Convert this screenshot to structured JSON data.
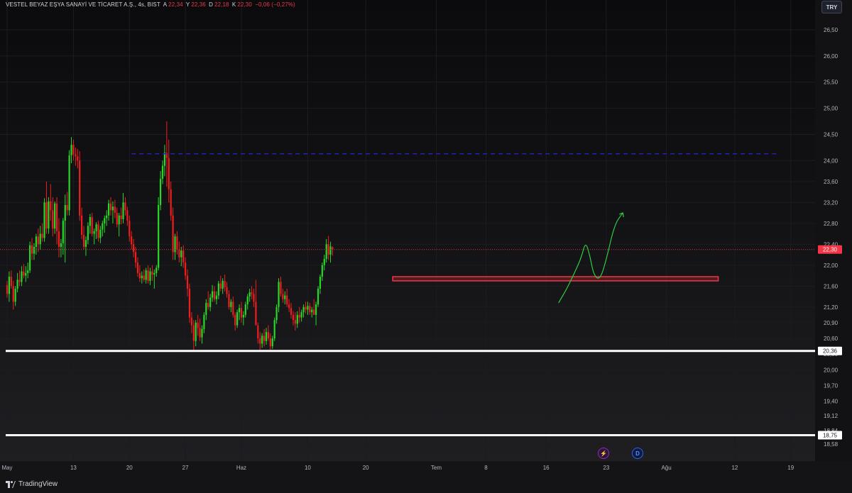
{
  "header": {
    "symbol": "VESTEL BEYAZ EŞYA SANAYİ VE TİCARET A.Ş., 4s, BIST",
    "open_label": "A",
    "open": "22,34",
    "high_label": "Y",
    "high": "22,36",
    "low_label": "D",
    "low": "22,18",
    "close_label": "K",
    "close": "22,30",
    "change": "−0,06 (−0,27%)"
  },
  "currency": "TRY",
  "footer": {
    "brand": "TradingView"
  },
  "event_icons": [
    {
      "icon": "lightning-icon",
      "glyph": "⚡",
      "color": "#9c27b0"
    },
    {
      "icon": "dividend-icon",
      "glyph": "D",
      "color": "#2962ff"
    }
  ],
  "chart_data": {
    "type": "candlestick",
    "ylim": [
      18.5,
      26.75
    ],
    "price_ticks": [
      "26,50",
      "26,00",
      "25,50",
      "25,00",
      "24,50",
      "24,00",
      "23,60",
      "23,20",
      "22,80",
      "22,40",
      "22,00",
      "21,60",
      "21,20",
      "20,90",
      "20,60",
      "20,30",
      "20,00",
      "19,70",
      "19,40",
      "19,12",
      "18,84",
      "18,58"
    ],
    "price_tick_values": [
      26.5,
      26.0,
      25.5,
      25.0,
      24.5,
      24.0,
      23.6,
      23.2,
      22.8,
      22.4,
      22.0,
      21.6,
      21.2,
      20.9,
      20.6,
      20.3,
      20.0,
      19.7,
      19.4,
      19.12,
      18.84,
      18.58
    ],
    "x_labels": [
      "May",
      "13",
      "20",
      "27",
      "Haz",
      "10",
      "20",
      "Tem",
      "8",
      "16",
      "23",
      "Ağu",
      "12",
      "19"
    ],
    "x_label_bars": [
      0,
      32,
      59,
      86,
      113,
      145,
      173,
      207,
      231,
      260,
      289,
      318,
      351,
      378
    ],
    "last_price": {
      "value": 22.3,
      "label": "22,30",
      "color": "#f23645"
    },
    "support_lines": [
      {
        "value": 20.36,
        "label": "20,36",
        "color": "#ffffff"
      },
      {
        "value": 18.75,
        "label": "18,75",
        "color": "#ffffff"
      }
    ],
    "resistance_dashed": {
      "value": 24.13,
      "start_bar": 60,
      "end_bar": 372,
      "color": "#2121b8"
    },
    "resistance_zone": {
      "top": 21.78,
      "bottom": 21.7,
      "start_bar": 186,
      "end_bar": 343,
      "color": "#f23645"
    },
    "projection_arrow": {
      "color": "#2ecc40",
      "points": [
        [
          266,
          21.28
        ],
        [
          270,
          21.55
        ],
        [
          274,
          21.88
        ],
        [
          277,
          22.15
        ],
        [
          279,
          22.45
        ],
        [
          281,
          22.2
        ],
        [
          283,
          21.8
        ],
        [
          286,
          21.72
        ],
        [
          289,
          22.1
        ],
        [
          293,
          22.78
        ],
        [
          297,
          23.0
        ]
      ]
    },
    "up_color": "#26d926",
    "down_color": "#f01d1d",
    "candles": [
      [
        21.62,
        21.7,
        21.38,
        21.45
      ],
      [
        21.45,
        21.88,
        21.3,
        21.78
      ],
      [
        21.78,
        21.9,
        21.55,
        21.6
      ],
      [
        21.6,
        21.7,
        21.15,
        21.3
      ],
      [
        21.3,
        21.6,
        21.22,
        21.55
      ],
      [
        21.55,
        21.85,
        21.48,
        21.72
      ],
      [
        21.72,
        21.9,
        21.6,
        21.68
      ],
      [
        21.68,
        21.98,
        21.6,
        21.88
      ],
      [
        21.88,
        22.02,
        21.75,
        21.8
      ],
      [
        21.8,
        21.98,
        21.68,
        21.85
      ],
      [
        21.85,
        22.05,
        21.75,
        21.9
      ],
      [
        21.9,
        22.45,
        21.85,
        22.38
      ],
      [
        22.38,
        22.52,
        22.1,
        22.22
      ],
      [
        22.22,
        22.42,
        22.1,
        22.35
      ],
      [
        22.35,
        22.6,
        22.2,
        22.55
      ],
      [
        22.55,
        22.7,
        22.25,
        22.4
      ],
      [
        22.4,
        22.75,
        22.3,
        22.6
      ],
      [
        22.6,
        22.8,
        22.45,
        22.52
      ],
      [
        22.52,
        23.28,
        22.45,
        23.2
      ],
      [
        23.2,
        23.6,
        22.6,
        22.7
      ],
      [
        22.7,
        23.3,
        22.6,
        23.22
      ],
      [
        23.22,
        23.55,
        22.85,
        23.05
      ],
      [
        23.05,
        23.3,
        22.55,
        22.7
      ],
      [
        22.7,
        23.22,
        22.6,
        23.18
      ],
      [
        23.18,
        23.3,
        22.4,
        22.65
      ],
      [
        22.65,
        22.9,
        22.15,
        22.35
      ],
      [
        22.35,
        22.5,
        22.15,
        22.42
      ],
      [
        22.42,
        22.9,
        22.2,
        22.85
      ],
      [
        22.85,
        23.35,
        22.05,
        23.15
      ],
      [
        23.15,
        23.4,
        22.95,
        23.05
      ],
      [
        23.05,
        24.2,
        22.95,
        24.1
      ],
      [
        24.1,
        24.45,
        23.95,
        24.3
      ],
      [
        24.3,
        24.4,
        24.0,
        24.12
      ],
      [
        24.12,
        24.25,
        23.9,
        24.08
      ],
      [
        24.08,
        24.22,
        23.85,
        24.0
      ],
      [
        24.0,
        24.18,
        22.85,
        22.95
      ],
      [
        22.95,
        23.1,
        22.5,
        22.58
      ],
      [
        22.58,
        22.75,
        22.3,
        22.35
      ],
      [
        22.35,
        22.55,
        22.18,
        22.48
      ],
      [
        22.48,
        22.82,
        22.4,
        22.75
      ],
      [
        22.75,
        22.98,
        22.6,
        22.92
      ],
      [
        22.92,
        23.0,
        22.55,
        22.6
      ],
      [
        22.6,
        22.7,
        22.4,
        22.65
      ],
      [
        22.65,
        22.82,
        22.5,
        22.78
      ],
      [
        22.78,
        22.85,
        22.45,
        22.52
      ],
      [
        22.52,
        22.75,
        22.42,
        22.68
      ],
      [
        22.68,
        22.85,
        22.55,
        22.8
      ],
      [
        22.8,
        22.95,
        22.62,
        22.9
      ],
      [
        22.9,
        23.05,
        22.75,
        22.95
      ],
      [
        22.95,
        23.25,
        22.85,
        23.18
      ],
      [
        23.18,
        23.3,
        22.95,
        23.05
      ],
      [
        23.05,
        23.22,
        22.8,
        23.12
      ],
      [
        23.12,
        23.25,
        22.9,
        23.0
      ],
      [
        23.0,
        23.1,
        22.72,
        22.78
      ],
      [
        22.78,
        23.0,
        22.55,
        22.95
      ],
      [
        22.95,
        23.1,
        22.78,
        22.88
      ],
      [
        22.88,
        23.38,
        22.8,
        23.2
      ],
      [
        23.2,
        23.3,
        22.95,
        23.05
      ],
      [
        23.05,
        23.12,
        22.75,
        22.85
      ],
      [
        22.85,
        22.95,
        22.45,
        22.55
      ],
      [
        22.55,
        22.65,
        22.3,
        22.4
      ],
      [
        22.4,
        22.5,
        22.15,
        22.25
      ],
      [
        22.25,
        22.35,
        21.95,
        22.05
      ],
      [
        22.05,
        22.15,
        21.78,
        21.85
      ],
      [
        21.85,
        22.0,
        21.68,
        21.75
      ],
      [
        21.75,
        21.88,
        21.65,
        21.8
      ],
      [
        21.8,
        21.92,
        21.68,
        21.72
      ],
      [
        21.72,
        21.95,
        21.65,
        21.9
      ],
      [
        21.9,
        22.0,
        21.65,
        21.7
      ],
      [
        21.7,
        21.95,
        21.62,
        21.88
      ],
      [
        21.88,
        22.0,
        21.7,
        21.82
      ],
      [
        21.82,
        21.92,
        21.55,
        21.85
      ],
      [
        21.85,
        22.0,
        21.78,
        21.95
      ],
      [
        21.95,
        23.3,
        21.9,
        23.15
      ],
      [
        23.15,
        23.8,
        23.05,
        23.65
      ],
      [
        23.65,
        24.0,
        23.55,
        23.9
      ],
      [
        23.9,
        24.3,
        23.7,
        24.15
      ],
      [
        24.15,
        24.75,
        23.5,
        24.05
      ],
      [
        24.05,
        24.4,
        23.2,
        23.45
      ],
      [
        23.45,
        23.6,
        22.85,
        22.95
      ],
      [
        22.95,
        23.1,
        22.1,
        22.25
      ],
      [
        22.25,
        22.6,
        22.1,
        22.55
      ],
      [
        22.55,
        22.65,
        22.2,
        22.3
      ],
      [
        22.3,
        22.45,
        22.05,
        22.15
      ],
      [
        22.15,
        22.35,
        21.98,
        22.28
      ],
      [
        22.28,
        22.38,
        21.95,
        22.05
      ],
      [
        22.05,
        22.15,
        21.72,
        21.8
      ],
      [
        21.8,
        21.92,
        21.4,
        21.55
      ],
      [
        21.55,
        21.65,
        20.9,
        21.0
      ],
      [
        21.0,
        21.1,
        20.7,
        20.85
      ],
      [
        20.85,
        20.95,
        20.35,
        20.55
      ],
      [
        20.55,
        20.95,
        20.45,
        20.9
      ],
      [
        20.9,
        21.05,
        20.65,
        20.8
      ],
      [
        20.8,
        20.98,
        20.55,
        20.62
      ],
      [
        20.62,
        20.85,
        20.5,
        20.78
      ],
      [
        20.78,
        21.1,
        20.7,
        21.05
      ],
      [
        21.05,
        21.35,
        20.95,
        21.28
      ],
      [
        21.28,
        21.5,
        21.15,
        21.2
      ],
      [
        21.2,
        21.45,
        21.12,
        21.38
      ],
      [
        21.38,
        21.62,
        21.3,
        21.5
      ],
      [
        21.5,
        21.6,
        21.3,
        21.35
      ],
      [
        21.35,
        21.5,
        21.25,
        21.42
      ],
      [
        21.42,
        21.7,
        21.35,
        21.65
      ],
      [
        21.65,
        21.8,
        21.5,
        21.55
      ],
      [
        21.55,
        21.75,
        21.45,
        21.7
      ],
      [
        21.7,
        21.82,
        21.5,
        21.58
      ],
      [
        21.58,
        21.68,
        21.38,
        21.45
      ],
      [
        21.45,
        21.52,
        21.15,
        21.2
      ],
      [
        21.2,
        21.35,
        21.1,
        21.3
      ],
      [
        21.3,
        21.4,
        21.0,
        21.05
      ],
      [
        21.05,
        21.1,
        20.75,
        20.85
      ],
      [
        20.85,
        21.15,
        20.8,
        21.1
      ],
      [
        21.1,
        21.25,
        20.95,
        21.18
      ],
      [
        21.18,
        21.3,
        20.9,
        21.0
      ],
      [
        21.0,
        21.12,
        20.85,
        21.05
      ],
      [
        21.05,
        21.3,
        21.0,
        21.25
      ],
      [
        21.25,
        21.45,
        21.15,
        21.4
      ],
      [
        21.4,
        21.55,
        21.3,
        21.48
      ],
      [
        21.48,
        21.6,
        21.35,
        21.45
      ],
      [
        21.45,
        21.55,
        21.2,
        21.3
      ],
      [
        21.3,
        21.72,
        21.25,
        20.85
      ],
      [
        20.85,
        20.9,
        20.5,
        20.6
      ],
      [
        20.6,
        20.72,
        20.38,
        20.5
      ],
      [
        20.5,
        20.7,
        20.42,
        20.65
      ],
      [
        20.65,
        20.78,
        20.45,
        20.55
      ],
      [
        20.55,
        20.8,
        20.48,
        20.72
      ],
      [
        20.72,
        20.85,
        20.55,
        20.6
      ],
      [
        20.6,
        20.7,
        20.38,
        20.45
      ],
      [
        20.45,
        20.65,
        20.4,
        20.6
      ],
      [
        20.6,
        21.0,
        20.55,
        20.95
      ],
      [
        20.95,
        21.25,
        20.88,
        21.2
      ],
      [
        21.2,
        21.75,
        21.1,
        21.68
      ],
      [
        21.68,
        21.78,
        21.4,
        21.45
      ],
      [
        21.45,
        21.55,
        21.28,
        21.35
      ],
      [
        21.35,
        21.5,
        21.25,
        21.42
      ],
      [
        21.42,
        21.55,
        21.2,
        21.25
      ],
      [
        21.25,
        21.35,
        21.1,
        21.18
      ],
      [
        21.18,
        21.28,
        20.98,
        21.05
      ],
      [
        21.05,
        21.12,
        20.85,
        20.95
      ],
      [
        20.95,
        21.1,
        20.75,
        20.88
      ],
      [
        20.88,
        21.12,
        20.8,
        21.05
      ],
      [
        21.05,
        21.2,
        20.9,
        21.0
      ],
      [
        21.0,
        21.15,
        20.92,
        21.1
      ],
      [
        21.1,
        21.25,
        21.0,
        21.2
      ],
      [
        21.2,
        21.3,
        21.08,
        21.15
      ],
      [
        21.15,
        21.3,
        21.05,
        21.22
      ],
      [
        21.22,
        21.28,
        21.05,
        21.1
      ],
      [
        21.1,
        21.2,
        21.0,
        21.15
      ],
      [
        21.15,
        21.35,
        21.08,
        21.05
      ],
      [
        21.05,
        21.3,
        20.85,
        21.25
      ],
      [
        21.25,
        21.6,
        21.2,
        21.55
      ],
      [
        21.55,
        21.82,
        21.45,
        21.78
      ],
      [
        21.78,
        22.05,
        21.7,
        22.0
      ],
      [
        22.0,
        22.2,
        21.9,
        22.12
      ],
      [
        22.12,
        22.5,
        22.05,
        22.4
      ],
      [
        22.4,
        22.56,
        22.1,
        22.2
      ],
      [
        22.2,
        22.45,
        22.05,
        22.36
      ],
      [
        22.34,
        22.36,
        22.18,
        22.3
      ]
    ]
  }
}
